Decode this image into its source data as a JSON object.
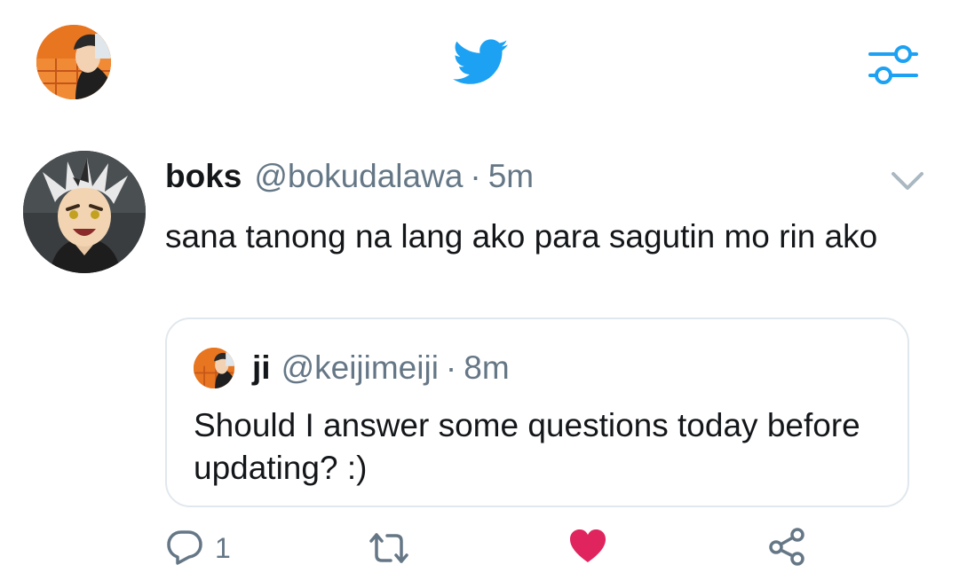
{
  "header": {
    "profile_avatar": "profile-avatar",
    "logo_icon": "twitter-bird-icon",
    "filter_icon": "sliders-icon"
  },
  "tweet": {
    "name": "boks",
    "handle": "@bokudalawa",
    "separator": "·",
    "time": "5m",
    "text": "sana tanong na lang ako para sagutin mo rin ako",
    "menu_icon": "chevron-down-icon"
  },
  "quoted_tweet": {
    "name": "ji",
    "handle": "@keijimeiji",
    "separator": "·",
    "time": "8m",
    "text": "Should I answer some questions today before updating? :)"
  },
  "actions": {
    "reply_icon": "reply-icon",
    "reply_count": "1",
    "retweet_icon": "retweet-icon",
    "like_icon": "heart-icon",
    "share_icon": "share-icon"
  },
  "colors": {
    "accent": "#1da1f2",
    "like": "#e0245e",
    "muted": "#657786",
    "border": "#e1e8ed"
  }
}
